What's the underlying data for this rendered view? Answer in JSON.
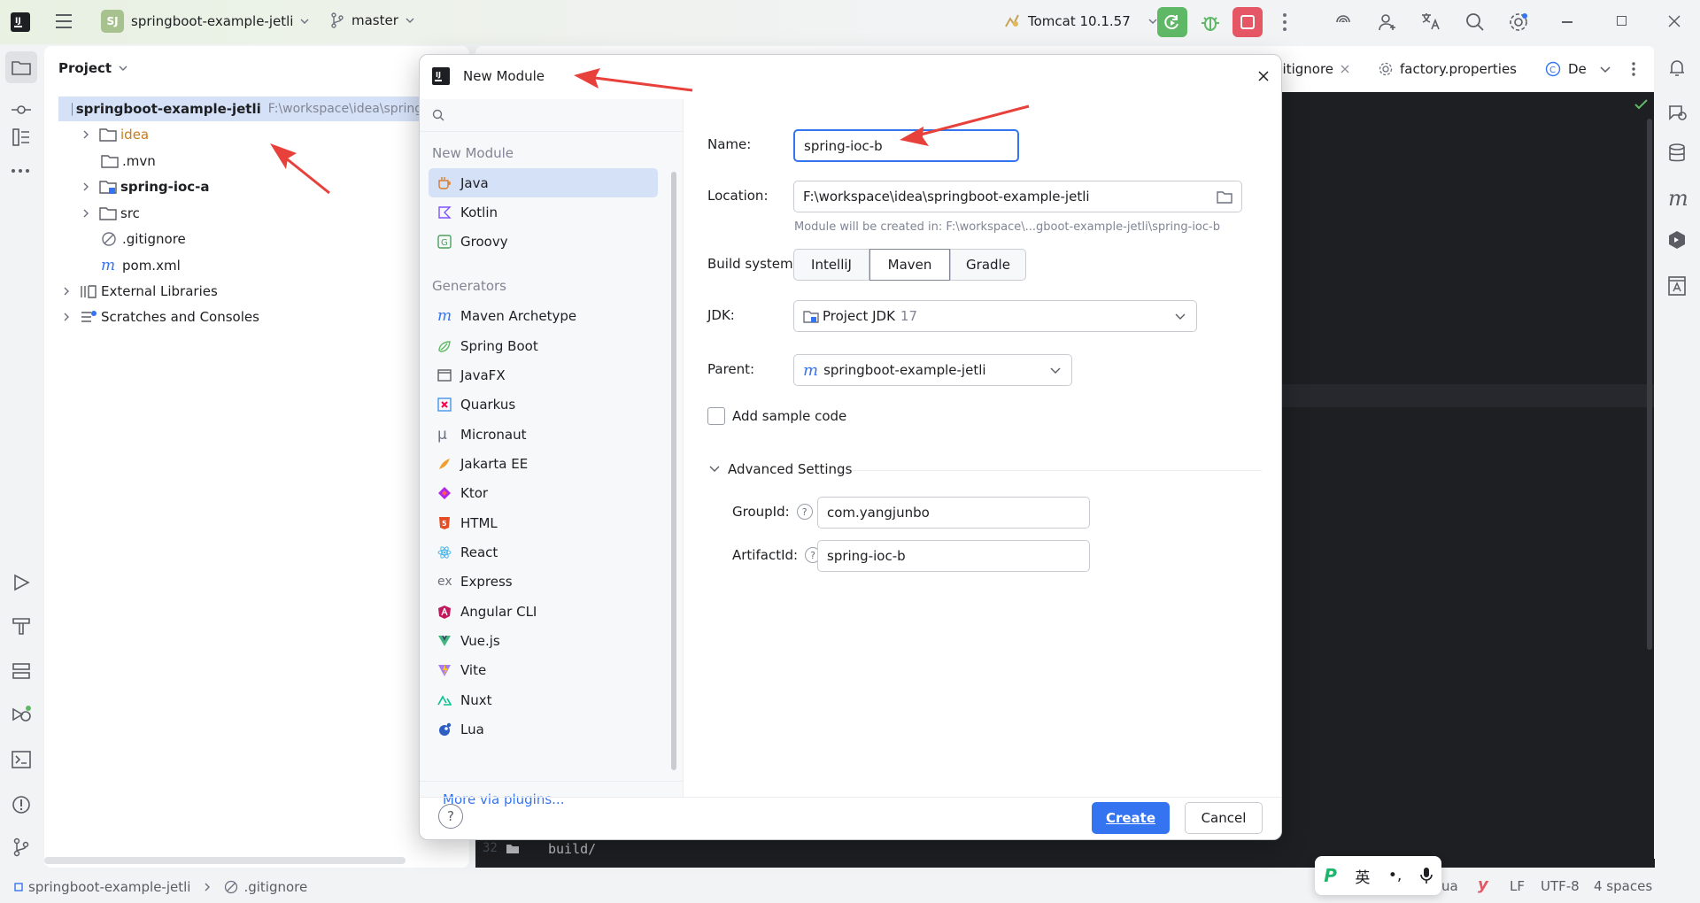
{
  "app": {
    "project_badge": "SJ",
    "project_name": "springboot-example-jetli",
    "branch": "master",
    "run_config": "Tomcat 10.1.57"
  },
  "project_panel": {
    "title": "Project",
    "root_label": "springboot-example-jetli",
    "root_path": "F:\\workspace\\idea\\springb",
    "items": [
      {
        "label": "idea",
        "name": "tree-item-idea"
      },
      {
        "label": ".mvn",
        "name": "tree-item-mvn"
      },
      {
        "label": "spring-ioc-a",
        "name": "tree-item-spring-ioc-a"
      },
      {
        "label": "src",
        "name": "tree-item-src"
      },
      {
        "label": ".gitignore",
        "name": "tree-item-gitignore"
      },
      {
        "label": "pom.xml",
        "name": "tree-item-pom"
      },
      {
        "label": "External Libraries",
        "name": "tree-item-external-libraries"
      },
      {
        "label": "Scratches and Consoles",
        "name": "tree-item-scratches"
      }
    ]
  },
  "editor": {
    "tabs": [
      {
        "label": "gitignore"
      },
      {
        "label": "factory.properties"
      },
      {
        "label": "De"
      }
    ],
    "line_number": "32",
    "code_line": "build/"
  },
  "statusbar": {
    "breadcrumb_root": "springboot-example-jetli",
    "breadcrumb_file": ".gitignore",
    "lang": "ua",
    "line_sep": "LF",
    "encoding": "UTF-8",
    "indent": "4 spaces"
  },
  "ime": {
    "lang": "英",
    "punct": "•,"
  },
  "dialog": {
    "title": "New Module",
    "search_placeholder": "",
    "section_new_module": "New Module",
    "new_module_items": [
      {
        "label": "Java"
      },
      {
        "label": "Kotlin"
      },
      {
        "label": "Groovy"
      }
    ],
    "section_generators": "Generators",
    "generator_items": [
      {
        "label": "Maven Archetype"
      },
      {
        "label": "Spring Boot"
      },
      {
        "label": "JavaFX"
      },
      {
        "label": "Quarkus"
      },
      {
        "label": "Micronaut"
      },
      {
        "label": "Jakarta EE"
      },
      {
        "label": "Ktor"
      },
      {
        "label": "HTML"
      },
      {
        "label": "React"
      },
      {
        "label": "Express"
      },
      {
        "label": "Angular CLI"
      },
      {
        "label": "Vue.js"
      },
      {
        "label": "Vite"
      },
      {
        "label": "Nuxt"
      },
      {
        "label": "Lua"
      }
    ],
    "more_plugins": "More via plugins...",
    "form": {
      "name_label": "Name:",
      "name_value": "spring-ioc-b",
      "location_label": "Location:",
      "location_value": "F:\\workspace\\idea\\springboot-example-jetli",
      "location_hint": "Module will be created in: F:\\workspace\\...gboot-example-jetli\\spring-ioc-b",
      "build_label": "Build system:",
      "build_options": [
        "IntelliJ",
        "Maven",
        "Gradle"
      ],
      "build_selected": "Maven",
      "jdk_label": "JDK:",
      "jdk_value": "Project JDK",
      "jdk_version": "17",
      "parent_label": "Parent:",
      "parent_value": "springboot-example-jetli",
      "sample_code_label": "Add sample code",
      "sample_code_checked": false,
      "advanced_label": "Advanced Settings",
      "groupid_label": "GroupId:",
      "groupid_value": "com.yangjunbo",
      "artifactid_label": "ArtifactId:",
      "artifactid_value": "spring-ioc-b"
    },
    "help_label": "?",
    "create_label": "Create",
    "cancel_label": "Cancel"
  },
  "colors": {
    "accent": "#3574f0",
    "annotation_arrow": "#e8403a",
    "run_green": "#5fb865",
    "stop_red": "#e55765"
  }
}
